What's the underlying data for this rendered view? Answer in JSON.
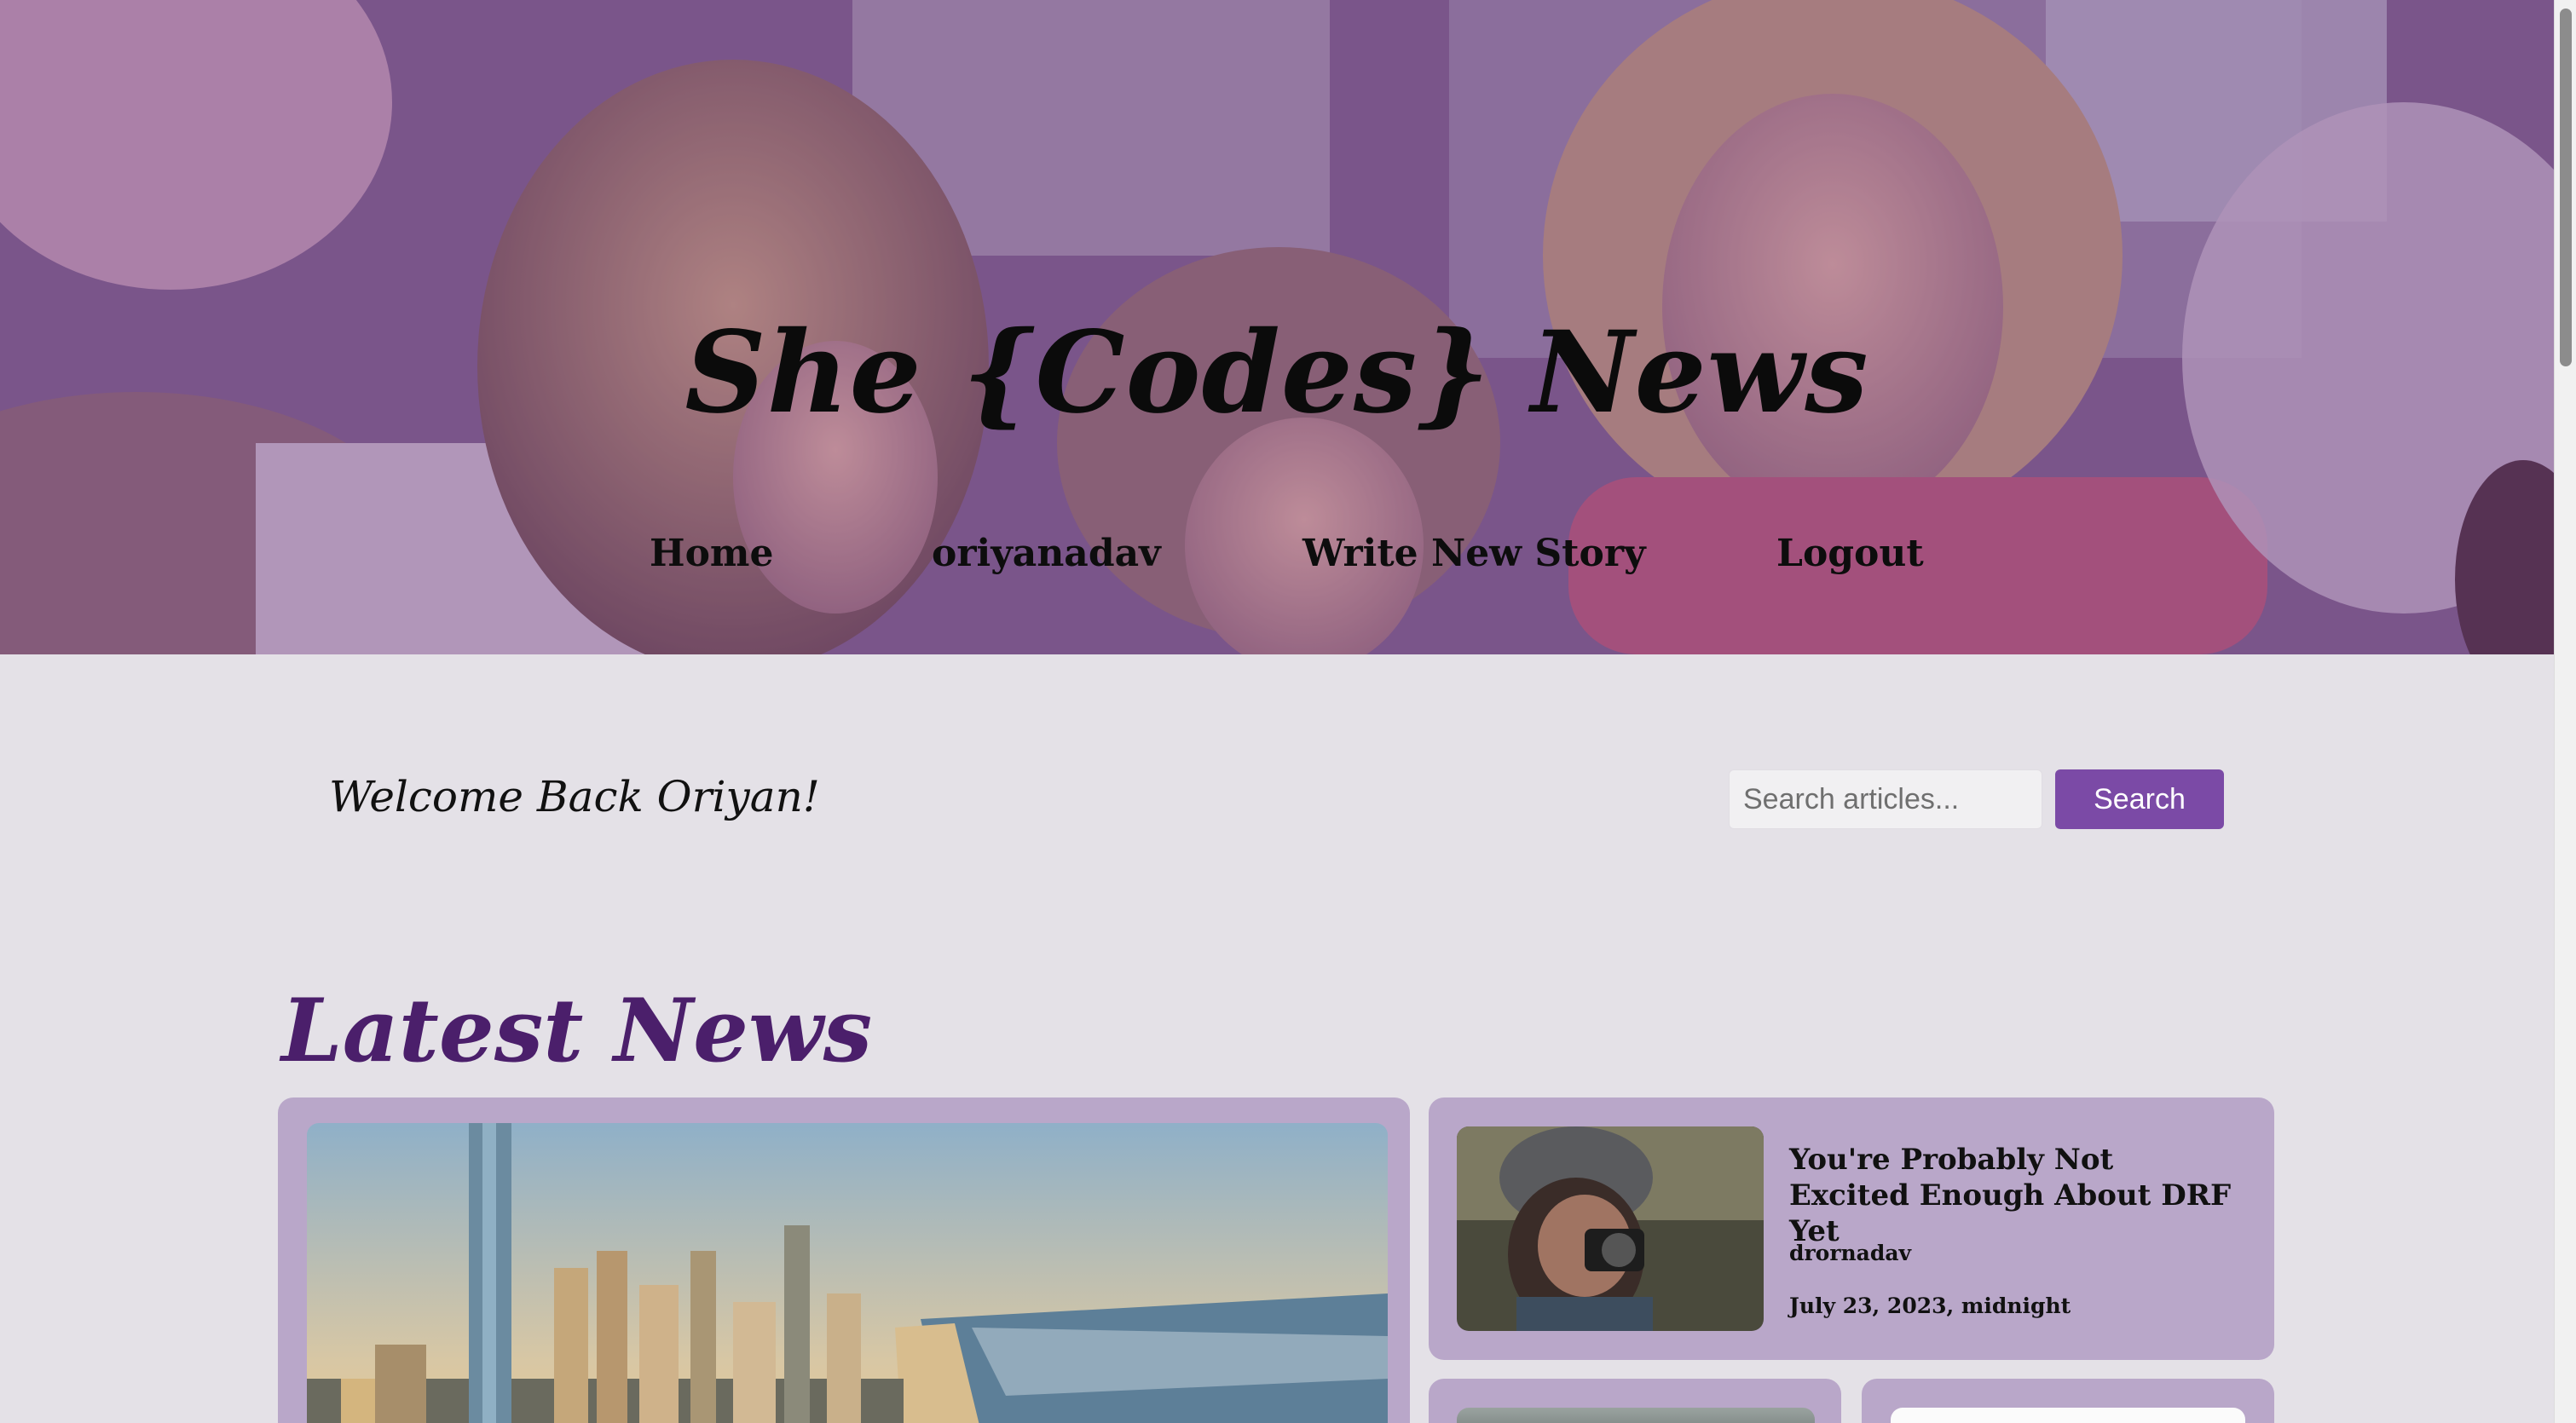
{
  "site": {
    "title": "She {Codes} News"
  },
  "nav": {
    "items": [
      {
        "label": "Home"
      },
      {
        "label": "oriyanadav"
      },
      {
        "label": "Write New Story"
      },
      {
        "label": "Logout"
      }
    ]
  },
  "welcome": {
    "text": "Welcome Back Oriyan!"
  },
  "search": {
    "placeholder": "Search articles...",
    "value": "",
    "button_label": "Search"
  },
  "latest": {
    "title": "Latest News",
    "featured": {
      "image": "coastal-city-skyline-photo"
    },
    "side_article": {
      "image": "woman-with-camera-photo",
      "headline": "You're Probably Not Excited Enough About DRF Yet",
      "author": "drornadav",
      "date": "July 23, 2023, midnight"
    }
  },
  "colors": {
    "page_bg": "#e4e1e7",
    "card_bg": "#b9a7c9",
    "accent": "#7b4aa6",
    "heading": "#4b1f6b"
  }
}
